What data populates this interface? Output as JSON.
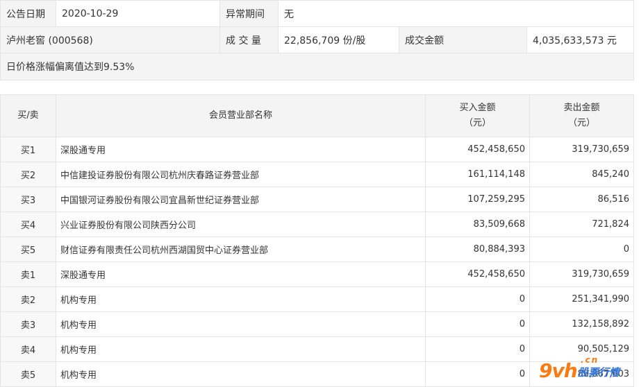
{
  "info": {
    "date_label": "公告日期",
    "date_value": "2020-10-29",
    "period_label": "异常期间",
    "period_value": "无",
    "stock": "泸州老窖 (000568)",
    "volume_label": "成 交 量",
    "volume_value": "22,856,709 份/股",
    "amount_label": "成交金额",
    "amount_value": "4,035,633,573 元",
    "reason": "日价格涨幅偏离值达到9.53%"
  },
  "table": {
    "headers": {
      "side": "买/卖",
      "name": "会员营业部名称",
      "buy": "买入金额",
      "buy_unit": "（元）",
      "sell": "卖出金额",
      "sell_unit": "（元）"
    },
    "rows": [
      {
        "side": "买1",
        "name": "深股通专用",
        "buy": "452,458,650",
        "sell": "319,730,659"
      },
      {
        "side": "买2",
        "name": "中信建投证券股份有限公司杭州庆春路证券营业部",
        "buy": "161,114,148",
        "sell": "845,240"
      },
      {
        "side": "买3",
        "name": "中国银河证券股份有限公司宜昌新世纪证券营业部",
        "buy": "107,259,295",
        "sell": "86,516"
      },
      {
        "side": "买4",
        "name": "兴业证券股份有限公司陕西分公司",
        "buy": "83,509,668",
        "sell": "721,824"
      },
      {
        "side": "买5",
        "name": "财信证券有限责任公司杭州西湖国贸中心证券营业部",
        "buy": "80,884,393",
        "sell": "0"
      },
      {
        "side": "卖1",
        "name": "深股通专用",
        "buy": "452,458,650",
        "sell": "319,730,659"
      },
      {
        "side": "卖2",
        "name": "机构专用",
        "buy": "0",
        "sell": "251,341,990"
      },
      {
        "side": "卖3",
        "name": "机构专用",
        "buy": "0",
        "sell": "132,158,892"
      },
      {
        "side": "卖4",
        "name": "机构专用",
        "buy": "0",
        "sell": "90,505,129"
      },
      {
        "side": "卖5",
        "name": "机构专用",
        "buy": "0",
        "sell": "89,867,003"
      }
    ]
  },
  "watermark": {
    "logo": "9vh",
    "domain": ".cn",
    "text": "股票行情"
  }
}
